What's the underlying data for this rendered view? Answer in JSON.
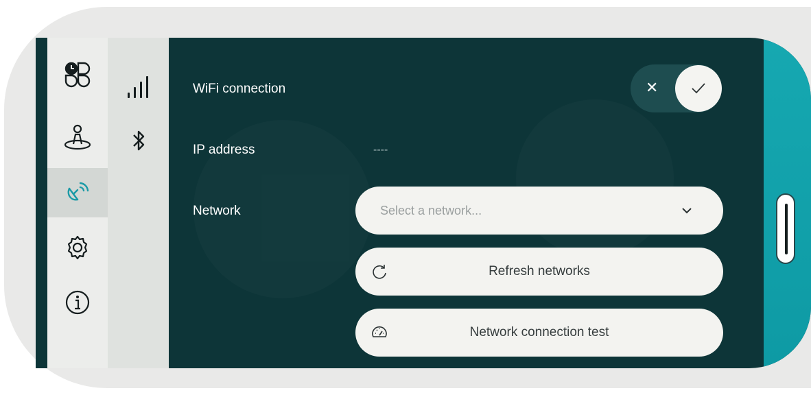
{
  "nav": {
    "items": [
      {
        "name": "dashboard",
        "icon": "dashboard-grid-icon",
        "active": false
      },
      {
        "name": "user",
        "icon": "user-platform-icon",
        "active": false
      },
      {
        "name": "connectivity",
        "icon": "satellite-dish-icon",
        "active": true
      },
      {
        "name": "settings",
        "icon": "gear-icon",
        "active": false
      },
      {
        "name": "info",
        "icon": "info-icon",
        "active": false
      }
    ]
  },
  "subnav": {
    "items": [
      {
        "name": "cellular",
        "icon": "signal-bars-icon"
      },
      {
        "name": "bluetooth",
        "icon": "bluetooth-icon"
      }
    ]
  },
  "wifi": {
    "label": "WiFi connection",
    "toggle_off_symbol": "✕",
    "enabled": true
  },
  "ip": {
    "label": "IP address",
    "value": "----"
  },
  "network": {
    "label": "Network",
    "placeholder": "Select a network...",
    "refresh_label": "Refresh networks",
    "test_label": "Network connection test"
  },
  "colors": {
    "background": "#0d3538",
    "accent": "#16a8b1",
    "sidebar": "#ecedeb",
    "pill": "#f3f3f0"
  }
}
